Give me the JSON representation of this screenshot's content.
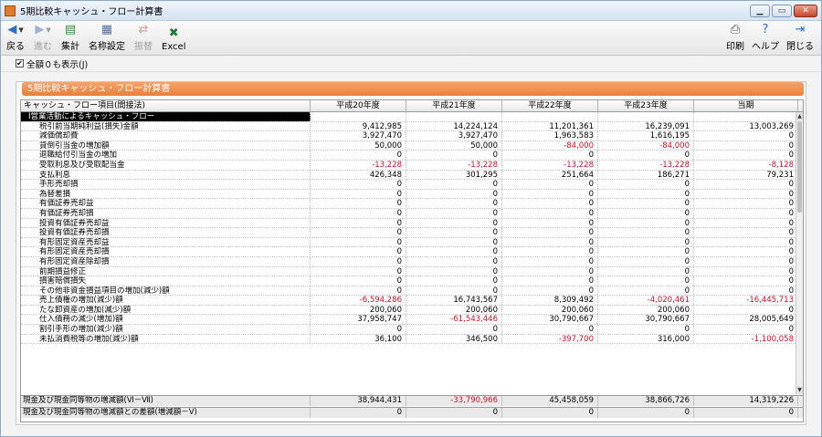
{
  "window": {
    "title": "5期比較キャッシュ・フロー計算書"
  },
  "toolbar": {
    "back": "戻る",
    "forward": "進む",
    "aggregate": "集計",
    "name_settings": "名称設定",
    "switch": "振替",
    "excel": "Excel",
    "print": "印刷",
    "help": "ヘルプ",
    "close": "閉じる"
  },
  "options": {
    "show_all": "全額０も表示(J)",
    "show_all_checked": true
  },
  "panel": {
    "title": "5期比較キャッシュ・フロー計算書"
  },
  "table": {
    "headers": [
      "キャッシュ・フロー項目(間接法)",
      "平成20年度",
      "平成21年度",
      "平成22年度",
      "平成23年度",
      "当期"
    ],
    "section": "Ⅰ営業活動によるキャッシュ・フロー",
    "rows": [
      [
        "税引前当期純利益(損失)金額",
        "9,412,985",
        "14,224,124",
        "11,201,361",
        "16,239,091",
        "13,003,269"
      ],
      [
        "減価償却費",
        "3,927,470",
        "3,927,470",
        "1,963,583",
        "1,616,195",
        "0"
      ],
      [
        "貸倒引当金の増加額",
        "50,000",
        "50,000",
        "-84,000",
        "-84,000",
        "0"
      ],
      [
        "退職給付引当金の増加",
        "0",
        "0",
        "0",
        "0",
        "0"
      ],
      [
        "受取利息及び受取配当金",
        "-13,228",
        "-13,228",
        "-13,228",
        "-13,228",
        "-8,128"
      ],
      [
        "支払利息",
        "426,348",
        "301,295",
        "251,664",
        "186,271",
        "79,231"
      ],
      [
        "手形売却損",
        "0",
        "0",
        "0",
        "0",
        "0"
      ],
      [
        "為替差損",
        "0",
        "0",
        "0",
        "0",
        "0"
      ],
      [
        "有価証券売却益",
        "0",
        "0",
        "0",
        "0",
        "0"
      ],
      [
        "有価証券売却損",
        "0",
        "0",
        "0",
        "0",
        "0"
      ],
      [
        "投資有価証券売却益",
        "0",
        "0",
        "0",
        "0",
        "0"
      ],
      [
        "投資有価証券売却損",
        "0",
        "0",
        "0",
        "0",
        "0"
      ],
      [
        "有形固定資産売却益",
        "0",
        "0",
        "0",
        "0",
        "0"
      ],
      [
        "有形固定資産売却損",
        "0",
        "0",
        "0",
        "0",
        "0"
      ],
      [
        "有形固定資産除却損",
        "0",
        "0",
        "0",
        "0",
        "0"
      ],
      [
        "前期損益修正",
        "0",
        "0",
        "0",
        "0",
        "0"
      ],
      [
        "損害賠償損失",
        "0",
        "0",
        "0",
        "0",
        "0"
      ],
      [
        "その他非資金損益項目の増加(減少)額",
        "0",
        "0",
        "0",
        "0",
        "0"
      ],
      [
        "売上債権の増加(減少)額",
        "-6,594,286",
        "16,743,567",
        "8,309,492",
        "-4,020,461",
        "-16,445,713"
      ],
      [
        "たな卸資産の増加(減少)額",
        "200,060",
        "200,060",
        "200,060",
        "200,060",
        "0"
      ],
      [
        "仕入債務の減少(増加)額",
        "37,958,747",
        "-61,543,446",
        "30,790,667",
        "30,790,667",
        "28,005,649"
      ],
      [
        "割引手形の増加(減少)額",
        "0",
        "0",
        "0",
        "0",
        "0"
      ],
      [
        "未払消費税等の増加(減少)額",
        "36,100",
        "346,500",
        "-397,700",
        "316,000",
        "-1,100,058"
      ]
    ],
    "footer": [
      [
        "現金及び現金同等物の増減額(Ⅵ－Ⅶ)",
        "38,944,431",
        "-33,790,966",
        "45,458,059",
        "38,866,726",
        "14,319,226"
      ],
      [
        "現金及び現金同等物の増減額との差額(増減額－Ⅴ)",
        "0",
        "0",
        "0",
        "0",
        "0"
      ]
    ]
  }
}
